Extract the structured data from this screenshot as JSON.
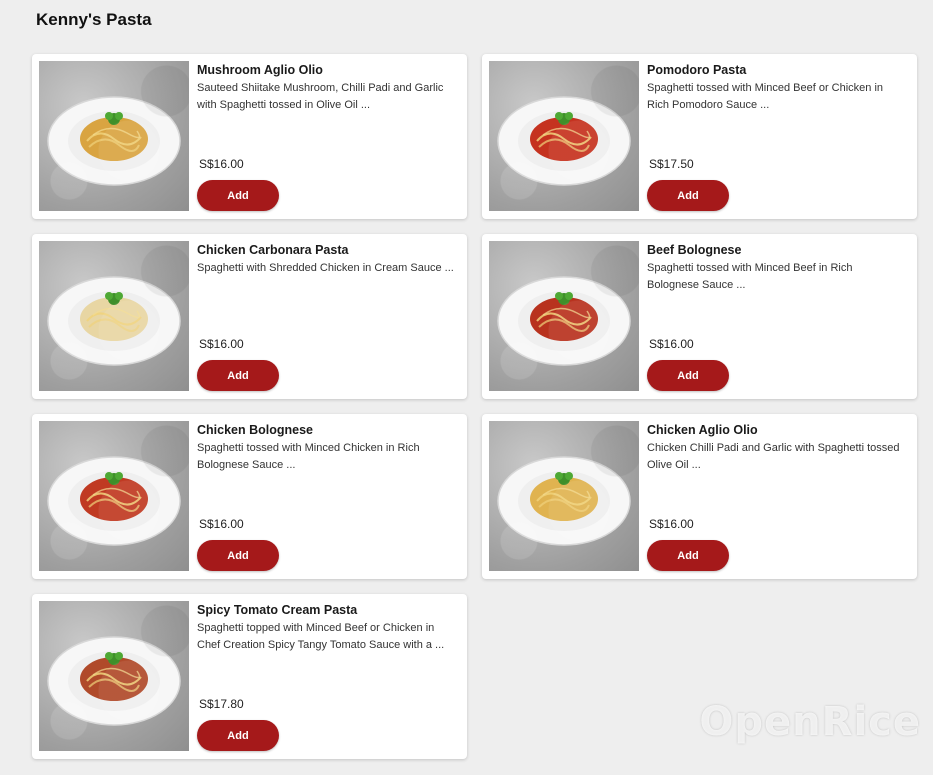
{
  "restaurant": {
    "section_title": "Kenny's Pasta"
  },
  "menu": {
    "items": [
      {
        "name": "Mushroom Aglio Olio",
        "description": "Sauteed Shiitake Mushroom, Chilli Padi and Garlic with Spaghetti tossed in Olive Oil ...",
        "price": "S$16.00",
        "add_label": "Add",
        "sauce": "#d9a441",
        "plate": "round"
      },
      {
        "name": "Pomodoro Pasta",
        "description": "Spaghetti tossed with Minced Beef or Chicken in Rich Pomodoro Sauce ...",
        "price": "S$17.50",
        "add_label": "Add",
        "sauce": "#c5321f",
        "plate": "round"
      },
      {
        "name": "Chicken Carbonara Pasta",
        "description": "Spaghetti with Shredded Chicken in Cream Sauce ...",
        "price": "S$16.00",
        "add_label": "Add",
        "sauce": "#e8d6a3",
        "plate": "round"
      },
      {
        "name": "Beef Bolognese",
        "description": "Spaghetti tossed with Minced Beef in Rich Bolognese Sauce ...",
        "price": "S$16.00",
        "add_label": "Add",
        "sauce": "#b8321e",
        "plate": "round"
      },
      {
        "name": "Chicken Bolognese",
        "description": "Spaghetti tossed with Minced Chicken in Rich Bolognese Sauce ...",
        "price": "S$16.00",
        "add_label": "Add",
        "sauce": "#c03a22",
        "plate": "round"
      },
      {
        "name": "Chicken Aglio Olio",
        "description": "Chicken Chilli Padi and Garlic with Spaghetti tossed Olive Oil ...",
        "price": "S$16.00",
        "add_label": "Add",
        "sauce": "#e0b350",
        "plate": "round"
      },
      {
        "name": "Spicy Tomato Cream Pasta",
        "description": "Spaghetti topped with Minced Beef or Chicken in Chef Creation Spicy Tangy Tomato Sauce with a ...",
        "price": "S$17.80",
        "add_label": "Add",
        "sauce": "#b04a2a",
        "plate": "round"
      }
    ]
  },
  "watermark": {
    "text": "OpenRice"
  },
  "colors": {
    "accent": "#a5191a",
    "background": "#eeeeee",
    "card": "#ffffff"
  }
}
